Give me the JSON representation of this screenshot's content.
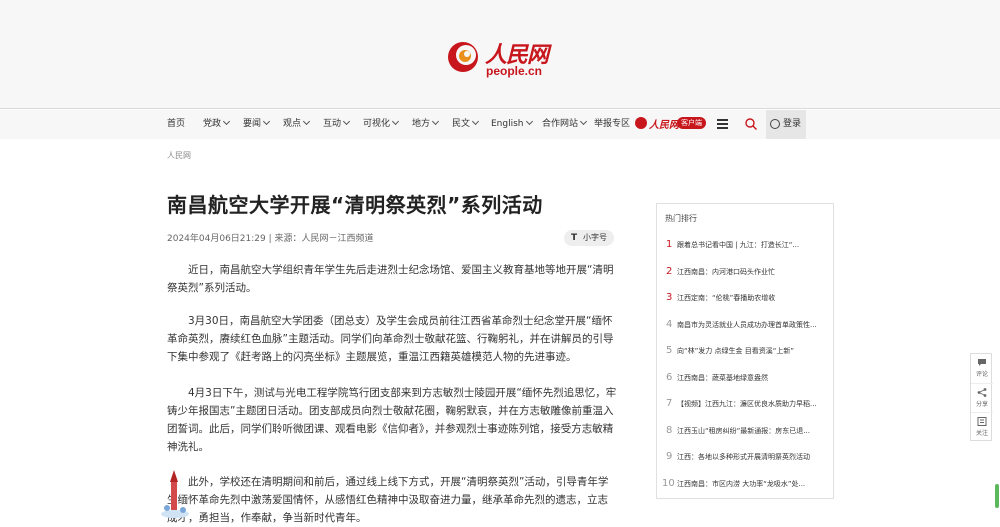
{
  "brand": {
    "logo_cn": "人民网",
    "logo_en": "people.cn",
    "color": "#c8161d"
  },
  "nav": {
    "items": [
      {
        "label": "首页",
        "dropdown": false
      },
      {
        "label": "党政",
        "dropdown": true
      },
      {
        "label": "要闻",
        "dropdown": true
      },
      {
        "label": "观点",
        "dropdown": true
      },
      {
        "label": "互动",
        "dropdown": true
      },
      {
        "label": "可视化",
        "dropdown": true
      },
      {
        "label": "地方",
        "dropdown": true
      },
      {
        "label": "民文",
        "dropdown": true
      },
      {
        "label": "English",
        "dropdown": true
      },
      {
        "label": "合作网站",
        "dropdown": true
      },
      {
        "label": "举报专区",
        "dropdown": false
      }
    ],
    "app_logo_text": "人民网+",
    "app_badge": "客户端",
    "menu_icon": "hamburger-icon",
    "search_icon": "search-icon",
    "login_label": "登录"
  },
  "breadcrumb": "人民网",
  "article": {
    "title": "南昌航空大学开展“清明祭英烈”系列活动",
    "meta": "2024年04月06日21:29 | 来源：人民网－江西频道",
    "font_toggle_icon": "T",
    "font_toggle_label": "小字号",
    "paragraphs": [
      "近日，南昌航空大学组织青年学生先后走进烈士纪念场馆、爱国主义教育基地等地开展“清明祭英烈”系列活动。",
      "3月30日，南昌航空大学团委（团总支）及学生会成员前往江西省革命烈士纪念堂开展“缅怀革命英烈，赓续红色血脉”主题活动。同学们向革命烈士敬献花篮、行鞠躬礼，并在讲解员的引导下集中参观了《赶考路上的闪亮坐标》主题展览，重温江西籍英雄模范人物的先进事迹。",
      "4月3日下午，测试与光电工程学院笃行团支部来到方志敏烈士陵园开展“缅怀先烈追思忆，牢铸少年报国志”主题团日活动。团支部成员向烈士敬献花圈，鞠躬默哀，并在方志敏雕像前重温入团誓词。此后，同学们聆听微团课、观看电影《信仰者》，并参观烈士事迹陈列馆，接受方志敏精神洗礼。",
      "此外，学校还在清明期间和前后，通过线上线下方式，开展“清明祭英烈”活动，引导青年学生缅怀革命先烈中激荡爱国情怀，从感悟红色精神中汲取奋进力量，继承革命先烈的遗志，立志成才，勇担当，作奉献，争当新时代青年。"
    ]
  },
  "hot": {
    "title": "热门排行",
    "items": [
      {
        "num": "1",
        "text": "跟着总书记看中国 | 九江：打造长江“..."
      },
      {
        "num": "2",
        "text": "江西南昌：内河港口码头作业忙"
      },
      {
        "num": "3",
        "text": "江西定南：“伦桃”春播助农增收"
      },
      {
        "num": "4",
        "text": "南昌市为灵活就业人员成功办理首单政策性..."
      },
      {
        "num": "5",
        "text": "向“林”发力 点绿生金 目看资溪“上新”"
      },
      {
        "num": "6",
        "text": "江西南昌：蔬菜基地绿意盎然"
      },
      {
        "num": "7",
        "text": "【视频】江西九江：濂区优良水质助力早稻..."
      },
      {
        "num": "8",
        "text": "江西玉山“租房纠纷”最新通报：房东已退..."
      },
      {
        "num": "9",
        "text": "江西：各地以多种形式开展清明祭英烈活动"
      },
      {
        "num": "10",
        "text": "江西南昌：市区内涝 大功率“龙吸水”处..."
      }
    ]
  },
  "float": {
    "comment": "评论",
    "share": "分享",
    "follow": "关注"
  }
}
